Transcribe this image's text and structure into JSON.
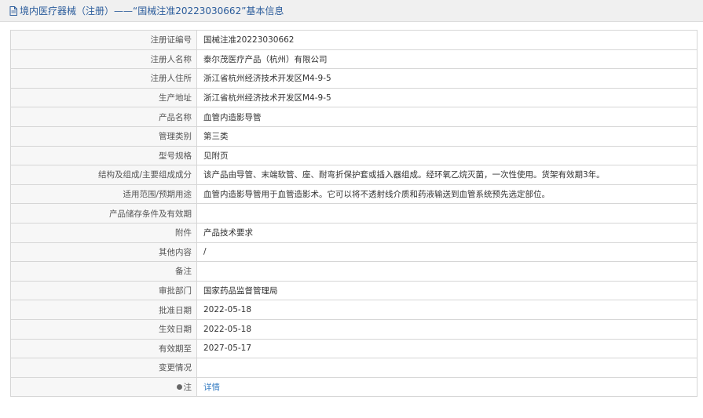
{
  "header": {
    "title": "境内医疗器械（注册）——“国械注准20223030662”基本信息",
    "icon": "document-icon"
  },
  "rows": [
    {
      "label": "注册证编号",
      "value": "国械注准20223030662"
    },
    {
      "label": "注册人名称",
      "value": "泰尔茂医疗产品（杭州）有限公司"
    },
    {
      "label": "注册人住所",
      "value": "浙江省杭州经济技术开发区M4-9-5"
    },
    {
      "label": "生产地址",
      "value": "浙江省杭州经济技术开发区M4-9-5"
    },
    {
      "label": "产品名称",
      "value": "血管内造影导管"
    },
    {
      "label": "管理类别",
      "value": "第三类"
    },
    {
      "label": "型号规格",
      "value": "见附页"
    },
    {
      "label": "结构及组成/主要组成成分",
      "value": "该产品由导管、末端软管、座、耐弯折保护套或插入器组成。经环氧乙烷灭菌，一次性使用。货架有效期3年。"
    },
    {
      "label": "适用范围/预期用途",
      "value": "血管内造影导管用于血管造影术。它可以将不透射线介质和药液输送到血管系统预先选定部位。"
    },
    {
      "label": "产品储存条件及有效期",
      "value": ""
    },
    {
      "label": "附件",
      "value": "产品技术要求"
    },
    {
      "label": "其他内容",
      "value": "/"
    },
    {
      "label": "备注",
      "value": ""
    },
    {
      "label": "审批部门",
      "value": "国家药品监督管理局"
    },
    {
      "label": "批准日期",
      "value": "2022-05-18"
    },
    {
      "label": "生效日期",
      "value": "2022-05-18"
    },
    {
      "label": "有效期至",
      "value": "2027-05-17"
    },
    {
      "label": "变更情况",
      "value": ""
    }
  ],
  "note_row": {
    "label": "注",
    "value": "详情",
    "icon": "note-dot-icon"
  },
  "colors": {
    "link": "#3a7fc4",
    "title": "#2b5c9b",
    "label_bg": "#f7f7f7",
    "border": "#d6d6d6"
  }
}
